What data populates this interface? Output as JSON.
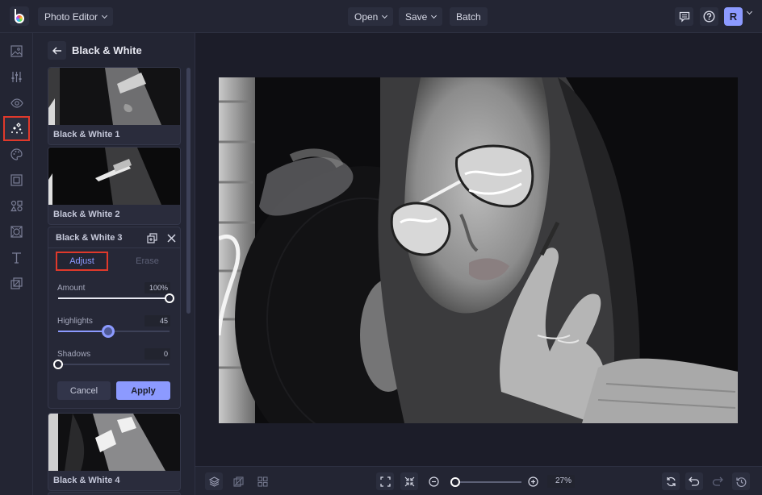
{
  "topbar": {
    "app_switcher_label": "Photo Editor",
    "open_label": "Open",
    "save_label": "Save",
    "batch_label": "Batch",
    "avatar_initial": "R"
  },
  "rail": {
    "items": [
      {
        "name": "image",
        "active": false
      },
      {
        "name": "adjustments",
        "active": false
      },
      {
        "name": "view",
        "active": false
      },
      {
        "name": "effects",
        "active": true
      },
      {
        "name": "artsy",
        "active": false
      },
      {
        "name": "frames",
        "active": false
      },
      {
        "name": "graphics",
        "active": false
      },
      {
        "name": "textures",
        "active": false
      },
      {
        "name": "text",
        "active": false
      },
      {
        "name": "overlays",
        "active": false
      }
    ]
  },
  "panel": {
    "title": "Black & White",
    "presets": [
      {
        "label": "Black & White 1"
      },
      {
        "label": "Black & White 2"
      },
      {
        "label": "Black & White 3"
      },
      {
        "label": "Black & White 4"
      }
    ],
    "editor": {
      "title": "Black & White 3",
      "tabs": [
        {
          "label": "Adjust",
          "active": true
        },
        {
          "label": "Erase",
          "active": false
        }
      ],
      "sliders": [
        {
          "label": "Amount",
          "display": "100%",
          "value": 100,
          "min": 0,
          "max": 100
        },
        {
          "label": "Highlights",
          "display": "45",
          "value": 45,
          "min": 0,
          "max": 100
        },
        {
          "label": "Shadows",
          "display": "0",
          "value": 0,
          "min": 0,
          "max": 100
        }
      ],
      "cancel_label": "Cancel",
      "apply_label": "Apply"
    }
  },
  "bottombar": {
    "zoom_display": "27%",
    "zoom_fraction": 0.05
  },
  "colors": {
    "accent": "#8c9aff",
    "highlight_box": "#e0392b",
    "background": "#1c1d29",
    "panel": "#232533"
  }
}
